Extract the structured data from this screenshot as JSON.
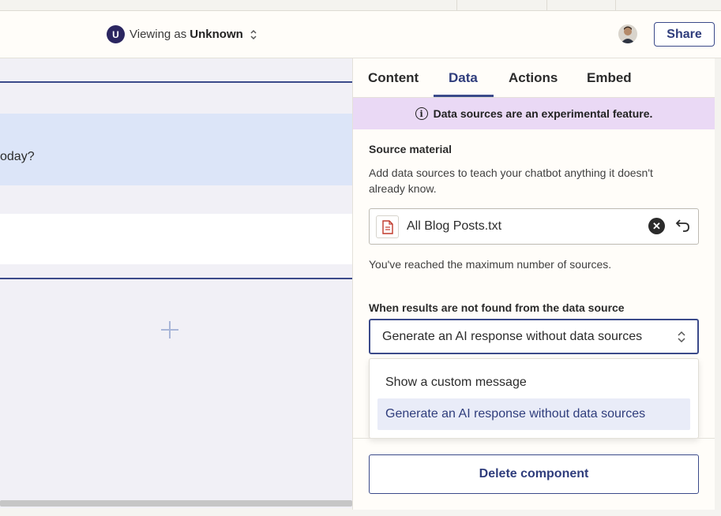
{
  "header": {
    "avatar_initial": "U",
    "viewing_prefix": "Viewing as",
    "viewing_user": "Unknown",
    "share_label": "Share"
  },
  "canvas": {
    "message_text": "oday?"
  },
  "panel": {
    "tabs": [
      {
        "label": "Content",
        "active": false
      },
      {
        "label": "Data",
        "active": true
      },
      {
        "label": "Actions",
        "active": false
      },
      {
        "label": "Embed",
        "active": false
      }
    ],
    "banner_text": "Data sources are an experimental feature.",
    "source_material": {
      "label": "Source material",
      "help_line1": "Add data sources to teach your chatbot anything it doesn't",
      "help_line2": "already know.",
      "file_name": "All Blog Posts.txt",
      "limit_text": "You've reached the maximum number of sources."
    },
    "not_found": {
      "label": "When results are not found from the data source",
      "selected_value": "Generate an AI response without data sources",
      "options": [
        "Show a custom message",
        "Generate an AI response without data sources"
      ]
    },
    "delete_label": "Delete component"
  },
  "colors": {
    "accent": "#3b4a8a",
    "banner_bg": "#ead9f5",
    "selected_option_bg": "#e9ecf8"
  },
  "icons": [
    "chevron-updown-icon",
    "info-icon",
    "document-icon",
    "clear-icon",
    "undo-icon",
    "plus-icon"
  ]
}
